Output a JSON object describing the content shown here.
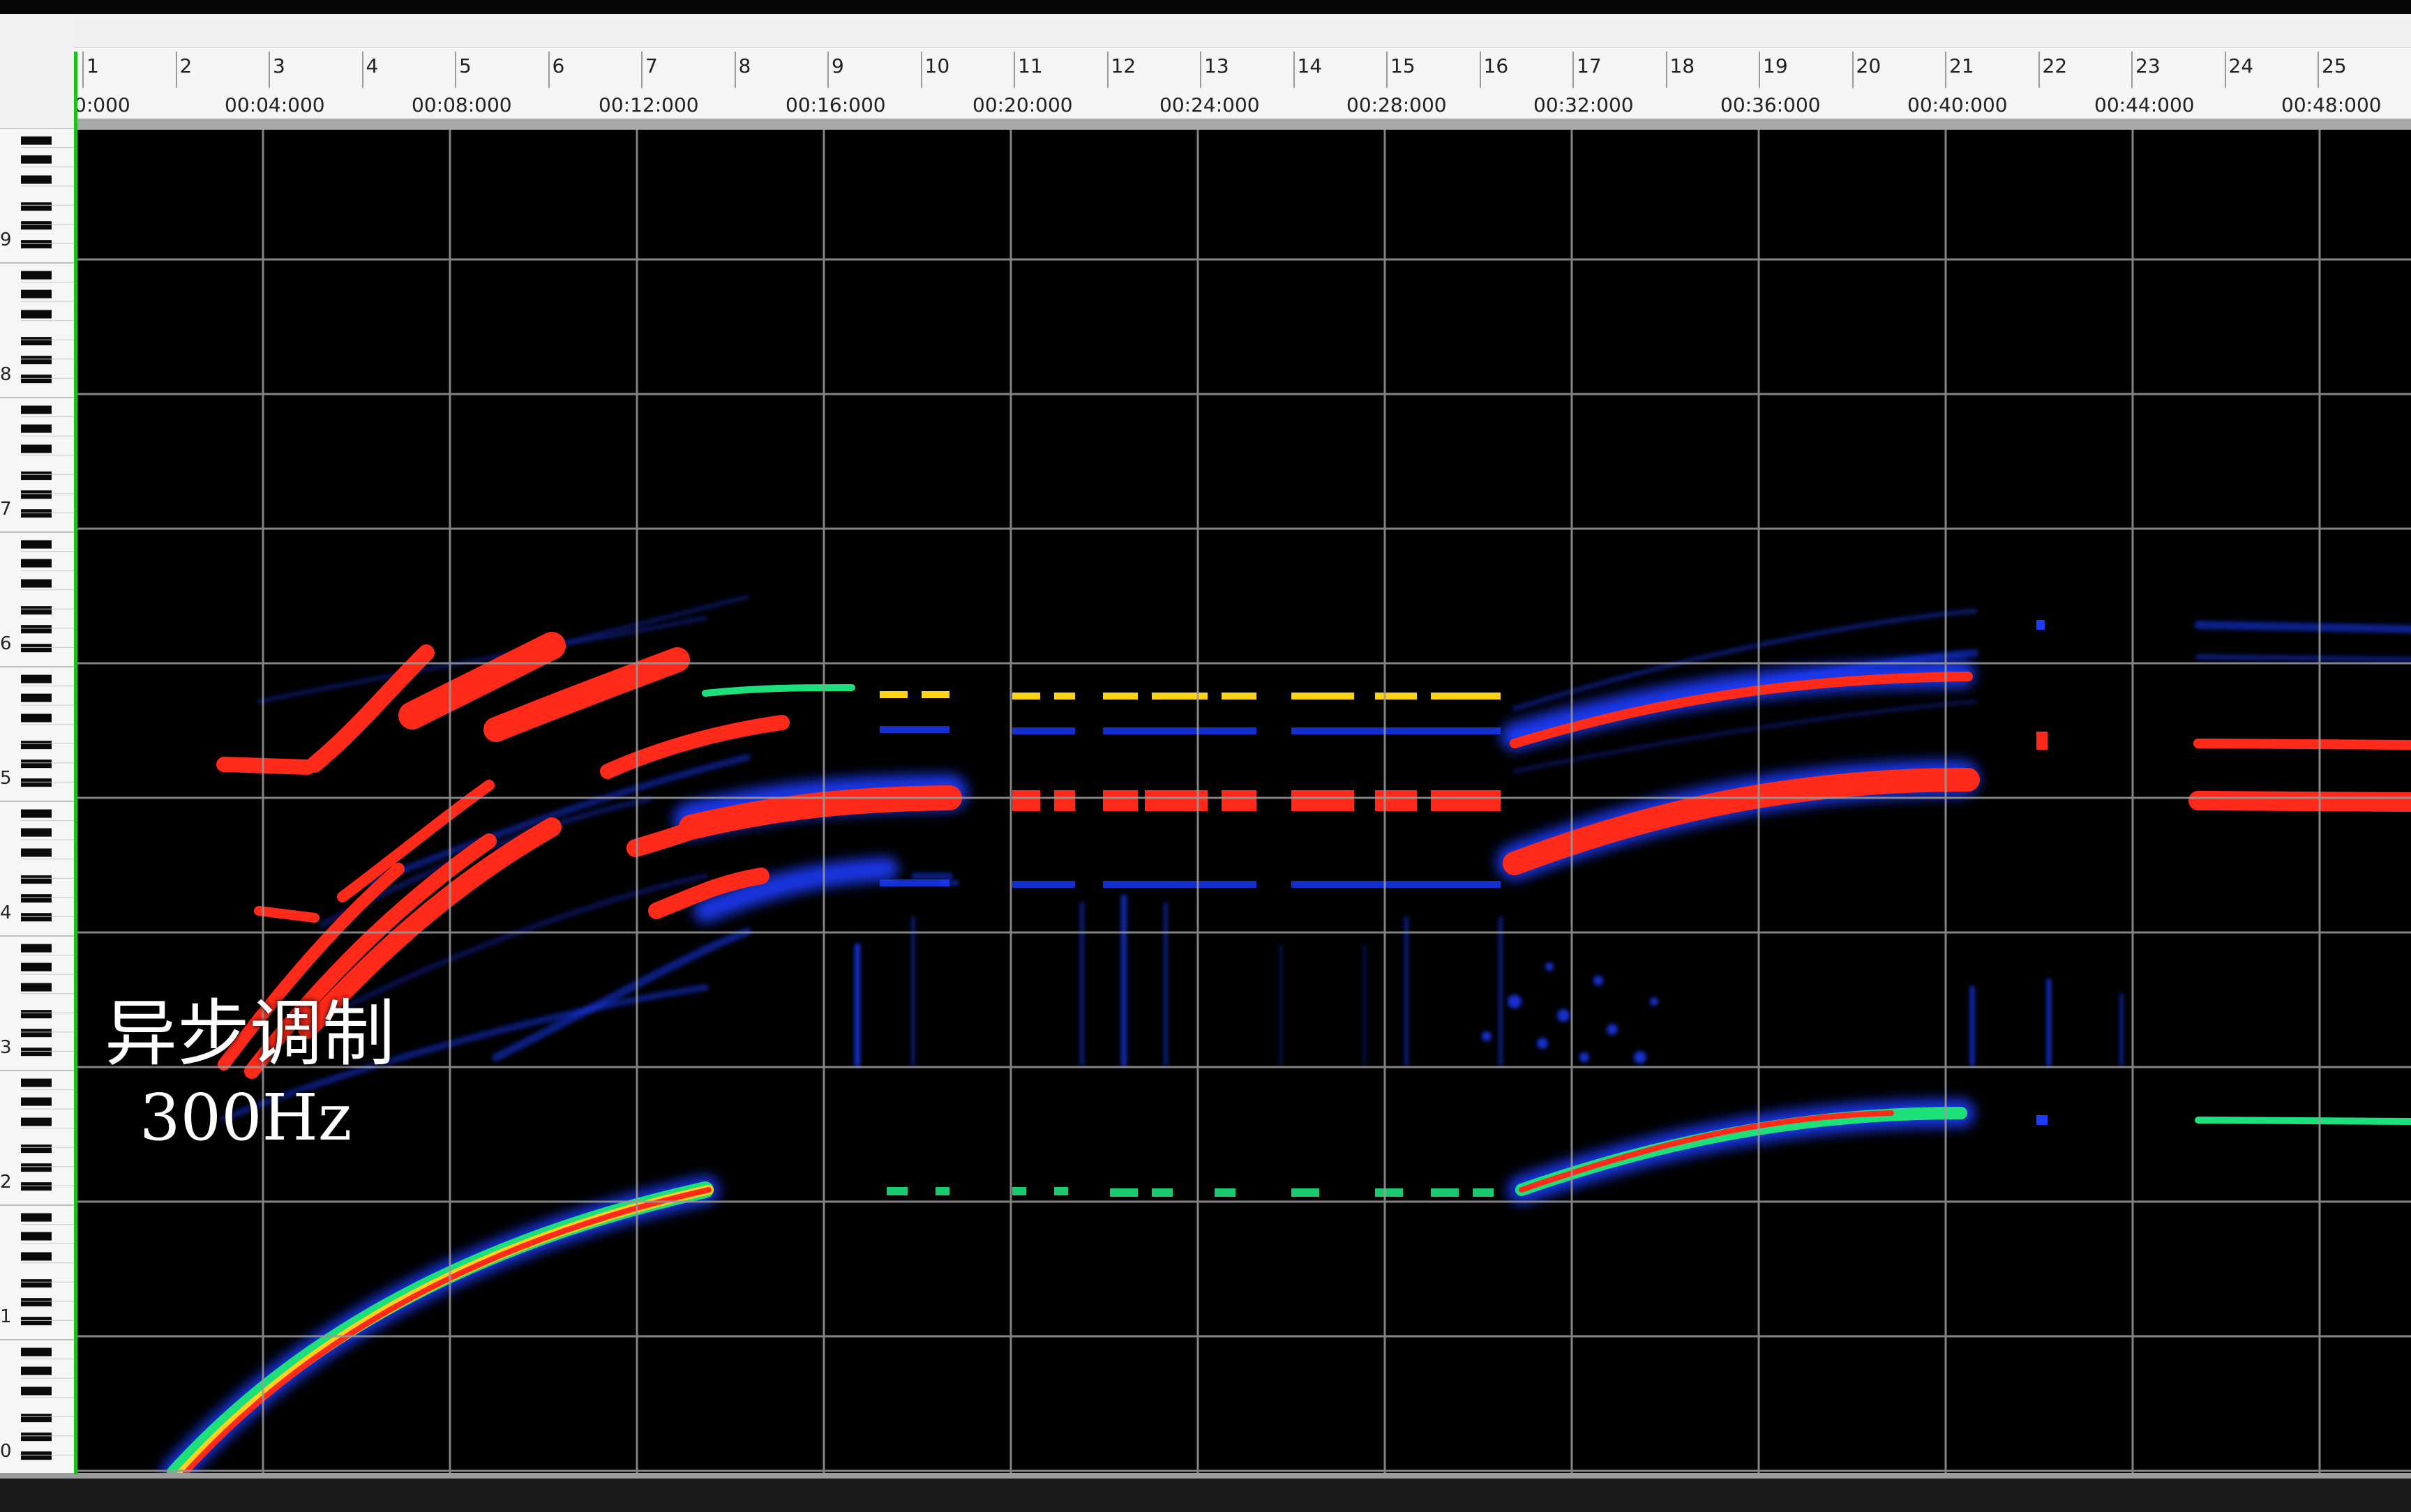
{
  "ruler": {
    "measures": [
      "1",
      "2",
      "3",
      "4",
      "5",
      "6",
      "7",
      "8",
      "9",
      "10",
      "11",
      "12",
      "13",
      "14",
      "15",
      "16",
      "17",
      "18",
      "19",
      "20",
      "21",
      "22",
      "23",
      "24",
      "25"
    ],
    "times": [
      "0:000",
      "00:04:000",
      "00:08:000",
      "00:12:000",
      "00:16:000",
      "00:20:000",
      "00:24:000",
      "00:28:000",
      "00:32:000",
      "00:36:000",
      "00:40:000",
      "00:44:000",
      "00:48:000"
    ]
  },
  "keyboard": {
    "octaves": [
      "9",
      "8",
      "7",
      "6",
      "5",
      "4",
      "3",
      "2",
      "1",
      "0"
    ]
  },
  "caption": {
    "line1": "异步调制",
    "line2": "300Hz"
  },
  "colors": {
    "background": "#000000",
    "grid": "#9a9a9a",
    "hot": "#ff2a1a",
    "warm": "#ffd21a",
    "mid": "#1ee07a",
    "cool": "#1a3cff",
    "playhead": "#1ec01e"
  }
}
